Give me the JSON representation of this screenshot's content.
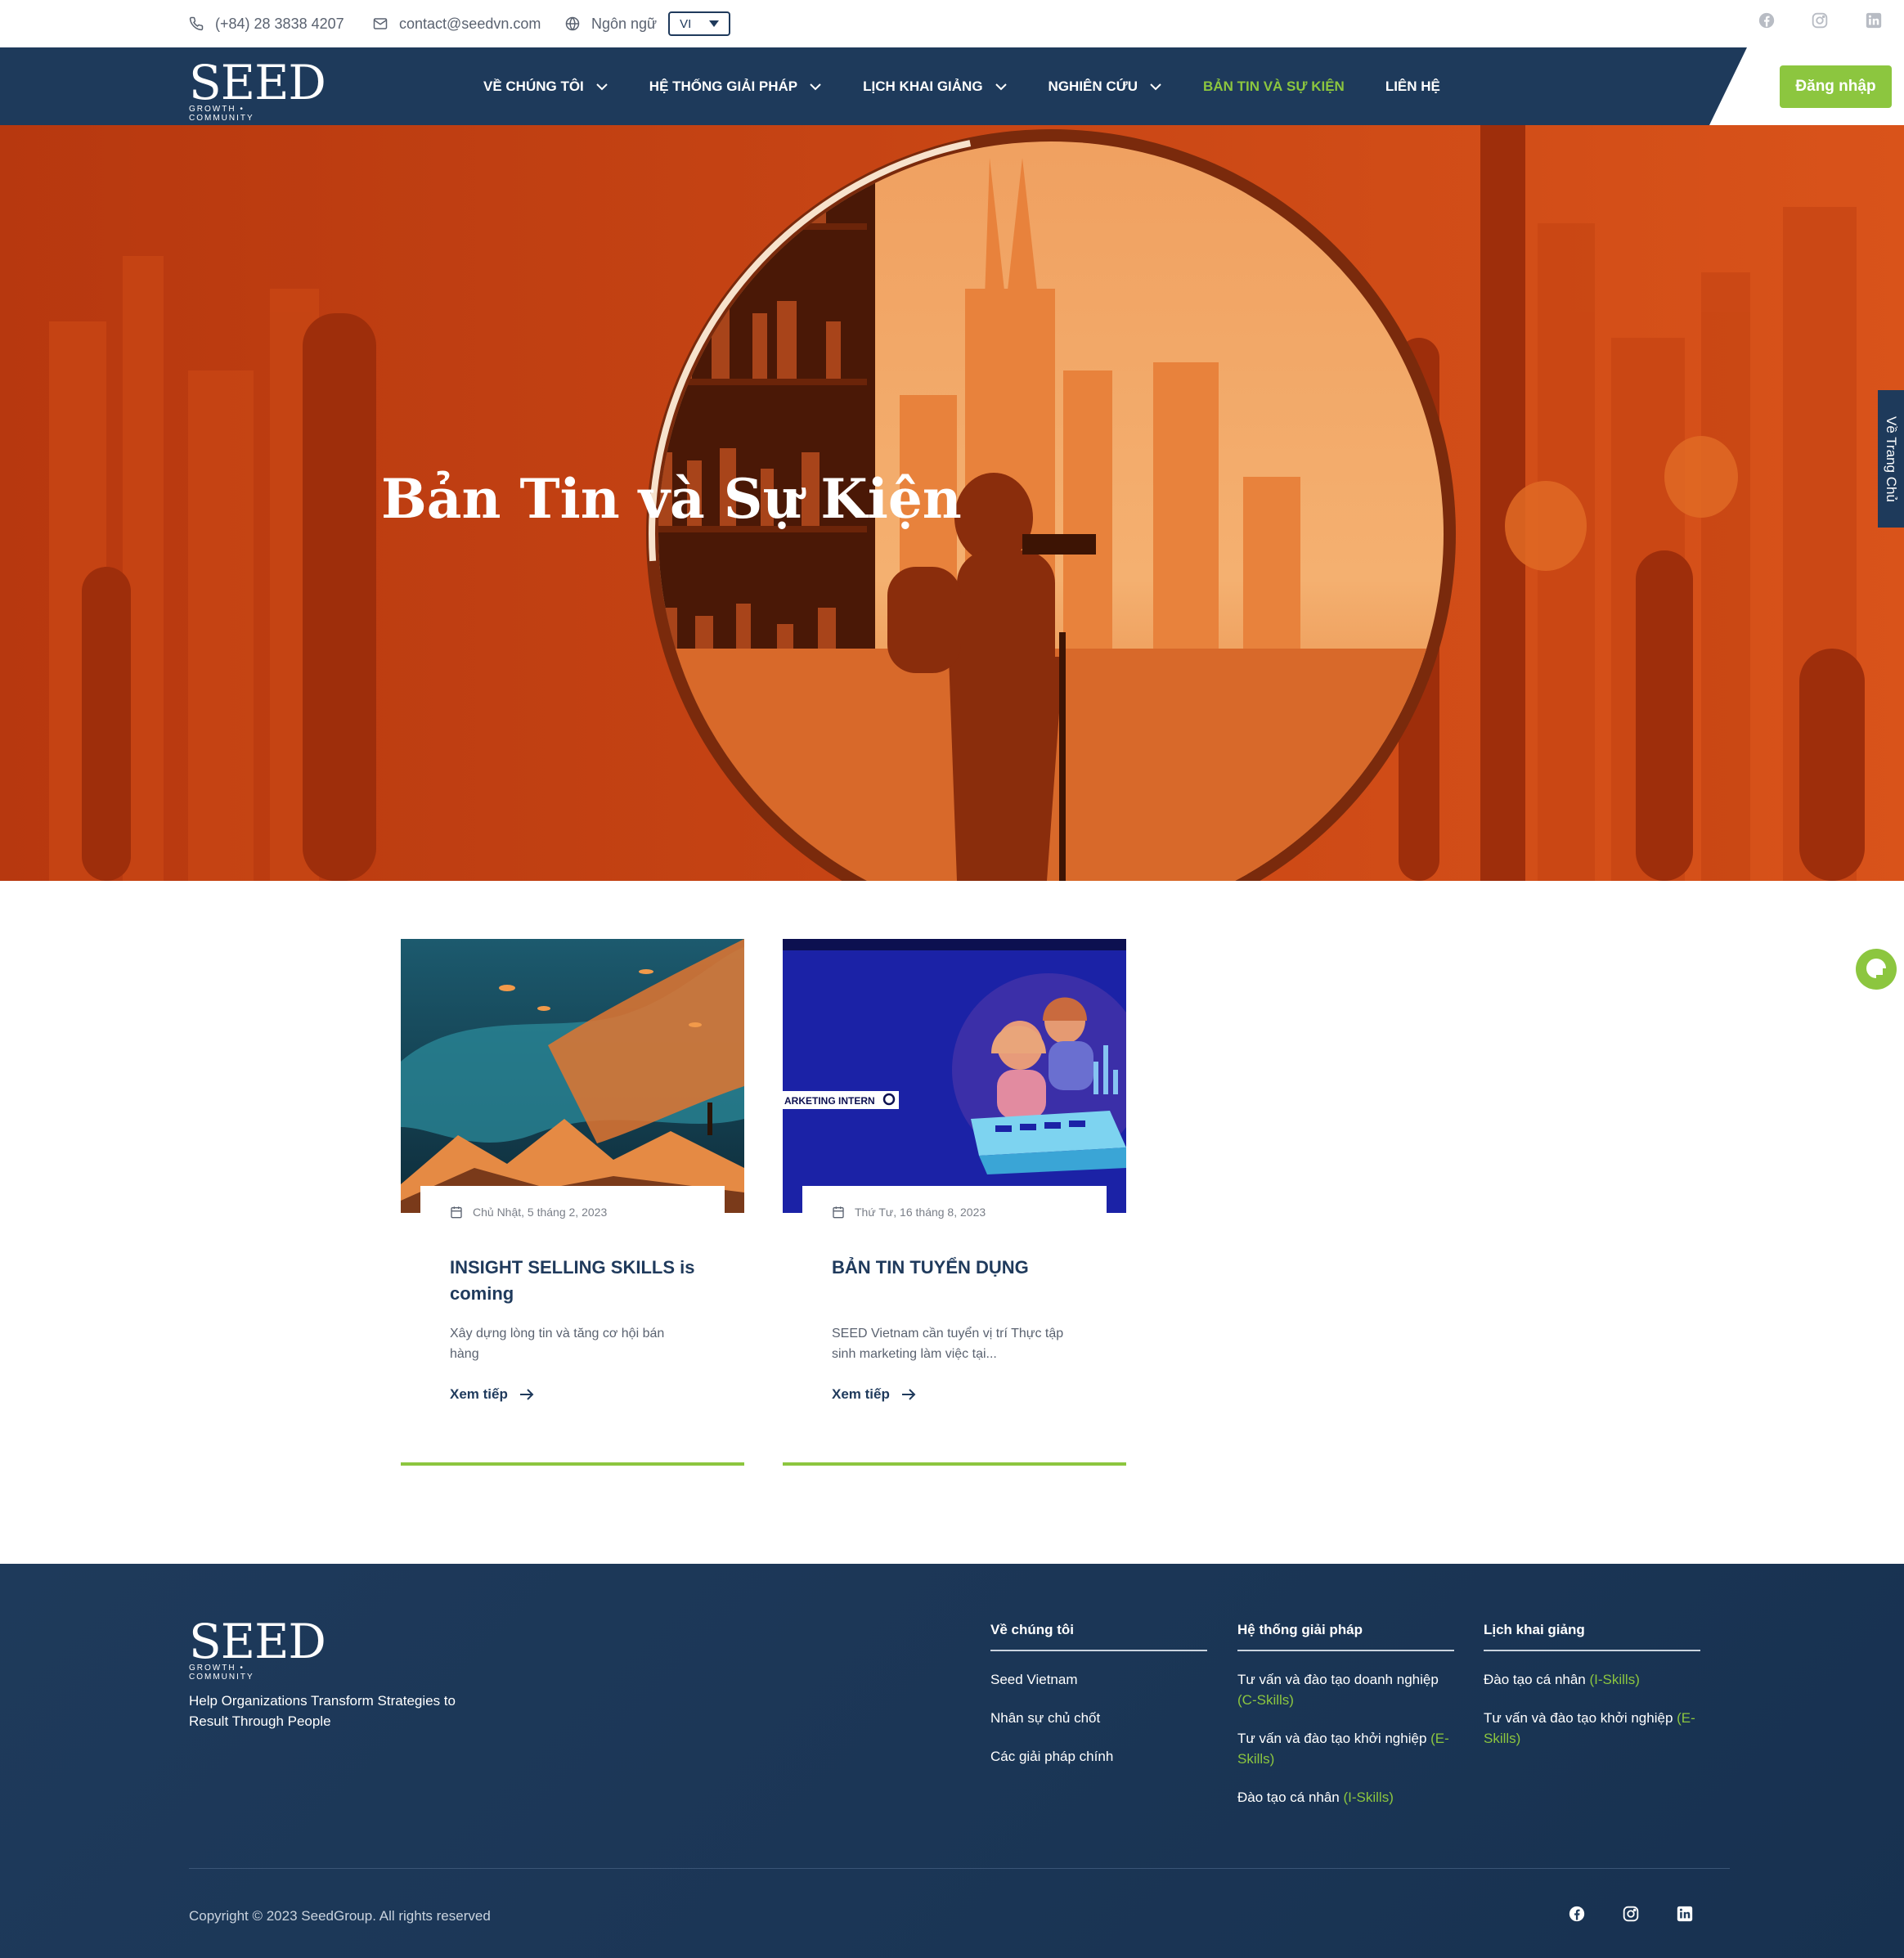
{
  "topbar": {
    "phone": "(+84) 28 3838 4207",
    "email": "contact@seedvn.com",
    "language_label": "Ngôn ngữ",
    "language_value": "VI",
    "social_icons": [
      "facebook-icon",
      "instagram-icon",
      "linkedin-icon"
    ]
  },
  "brand": {
    "name": "SEED",
    "tagline": "GROWTH • COMMUNITY"
  },
  "nav": {
    "items": [
      {
        "label": "VỀ CHÚNG TÔI",
        "has_dropdown": true
      },
      {
        "label": "HỆ THỐNG GIẢI PHÁP",
        "has_dropdown": true
      },
      {
        "label": "LỊCH KHAI GIẢNG",
        "has_dropdown": true
      },
      {
        "label": "NGHIÊN CỨU",
        "has_dropdown": true
      },
      {
        "label": "BẢN TIN VÀ SỰ KIỆN",
        "has_dropdown": false,
        "active": true
      },
      {
        "label": "LIÊN HỆ",
        "has_dropdown": false
      }
    ],
    "login_label": "Đăng nhập"
  },
  "hero": {
    "title": "Bản Tin và Sự Kiện",
    "side_tab": "Về Trang Chủ"
  },
  "posts": [
    {
      "date": "Chủ Nhật, 5 tháng 2, 2023",
      "title": "INSIGHT SELLING SKILLS is coming",
      "excerpt": "Xây dựng lòng tin và tăng cơ hội bán hàng",
      "more": "Xem tiếp"
    },
    {
      "date": "Thứ Tư, 16 tháng 8, 2023",
      "title": "BẢN TIN TUYỂN DỤNG",
      "excerpt": "SEED Vietnam cần tuyển vị trí Thực tập sinh marketing làm việc tại...",
      "more": "Xem tiếp",
      "image_text": "ARKETING INTERN"
    }
  ],
  "footer": {
    "tagline": "Help Organizations Transform Strategies to Result Through People",
    "columns": [
      {
        "heading": "Về chúng tôi",
        "links": [
          {
            "text": "Seed Vietnam",
            "highlight": ""
          },
          {
            "text": "Nhân sự chủ chốt",
            "highlight": ""
          },
          {
            "text": "Các giải pháp chính",
            "highlight": ""
          }
        ]
      },
      {
        "heading": "Hệ thống giải pháp",
        "links": [
          {
            "text": "Tư vấn và đào tạo doanh nghiệp ",
            "highlight": "(C-Skills)"
          },
          {
            "text": "Tư vấn và đào tạo khởi nghiệp ",
            "highlight": "(E-Skills)"
          },
          {
            "text": "Đào tạo cá nhân ",
            "highlight": "(I-Skills)"
          }
        ]
      },
      {
        "heading": "Lịch khai giảng",
        "links": [
          {
            "text": "Đào tạo cá nhân ",
            "highlight": "(I-Skills)"
          },
          {
            "text": "Tư vấn và đào tạo khởi nghiệp ",
            "highlight": "(E-Skills)"
          }
        ]
      }
    ],
    "copyright": "Copyright © 2023 SeedGroup. All rights reserved"
  },
  "colors": {
    "navy": "#1e3a5b",
    "accent_green": "#8cc63f",
    "hero_orange": "#e8651f"
  }
}
